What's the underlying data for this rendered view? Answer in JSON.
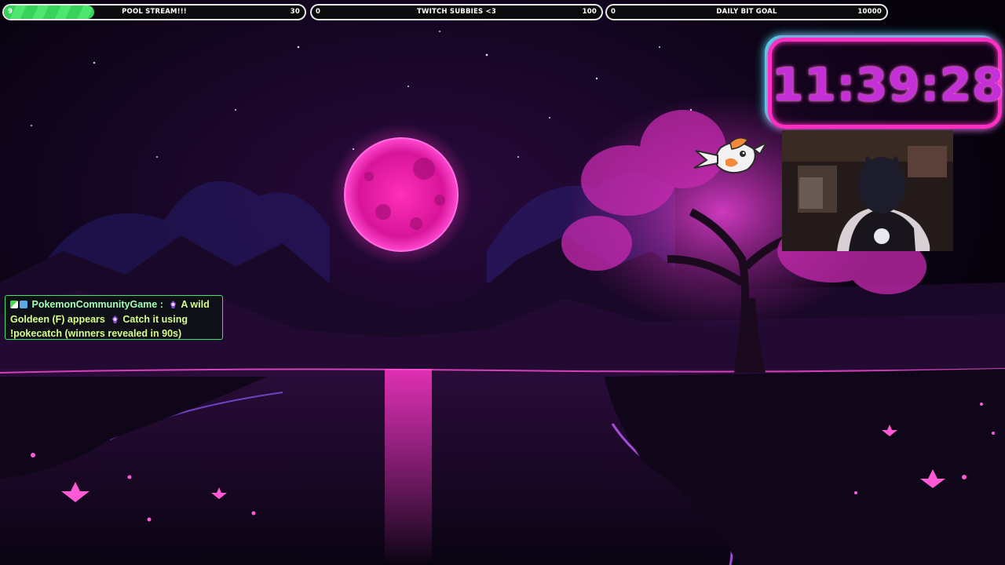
{
  "goals": [
    {
      "label": "POOL STREAM!!!",
      "current": "9",
      "target": "30",
      "progress": 0.3
    },
    {
      "label": "TWITCH SUBBIES <3",
      "current": "0",
      "target": "100",
      "progress": 0
    },
    {
      "label": "DAILY BIT GOAL",
      "current": "0",
      "target": "10000",
      "progress": 0
    }
  ],
  "timer": {
    "time": "11:39:28"
  },
  "chat": {
    "username": "PokemonCommunityGame",
    "separator": ":",
    "message_part1": "A wild Goldeen (F) appears",
    "message_part2": "Catch it using !pokecatch (winners revealed in 90s)"
  },
  "colors": {
    "accent_pink": "#ff2fc3",
    "accent_cyan": "#2ff0ea",
    "goal_fill": "#37d25a",
    "chat_border": "#3ee46e"
  },
  "icons": {
    "badges": [
      "mod-sword-icon",
      "bot-icon"
    ],
    "emote": "pokeball-emote-icon",
    "sprite": "goldeen-sprite-icon"
  }
}
